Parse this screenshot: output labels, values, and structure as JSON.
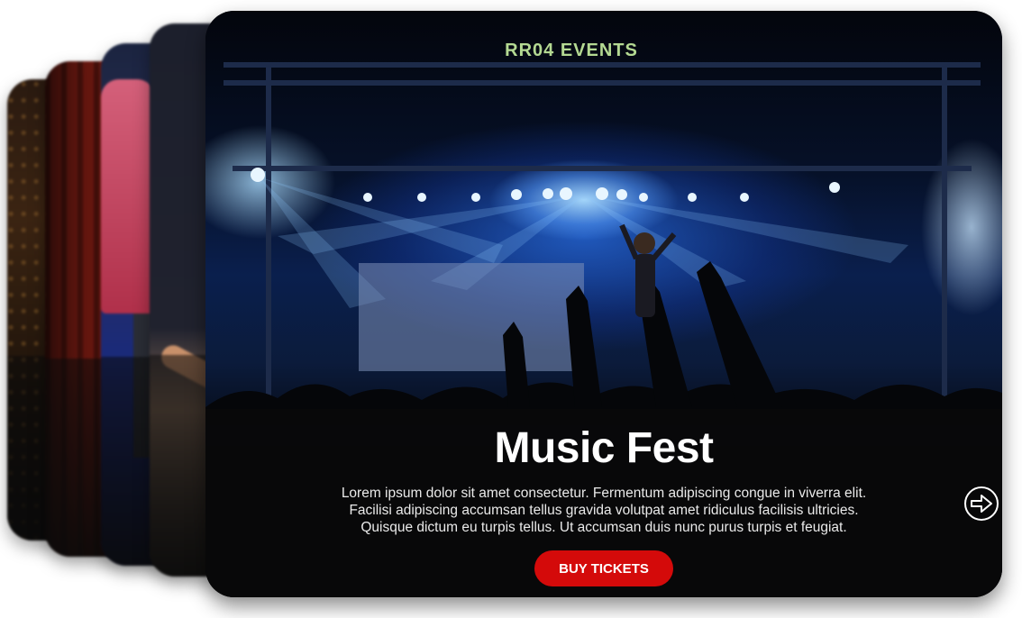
{
  "carousel": {
    "active_slide": {
      "title": "Music Fest",
      "banner_text": "RR04 EVENTS",
      "description_lines": [
        "Lorem ipsum dolor sit amet consectetur. Fermentum adipiscing congue in viverra elit.",
        "Facilisi adipiscing accumsan tellus gravida volutpat amet ridiculus facilisis ultricies.",
        "Quisque dictum eu turpis tellus. Ut accumsan duis nunc purus turpis et feugiat."
      ],
      "cta_label": "BUY TICKETS"
    },
    "next_icon": "arrow-right-circle-icon",
    "colors": {
      "cta_background": "#d40a0a",
      "caption_background": "#08080a",
      "title_text": "#ffffff"
    }
  }
}
